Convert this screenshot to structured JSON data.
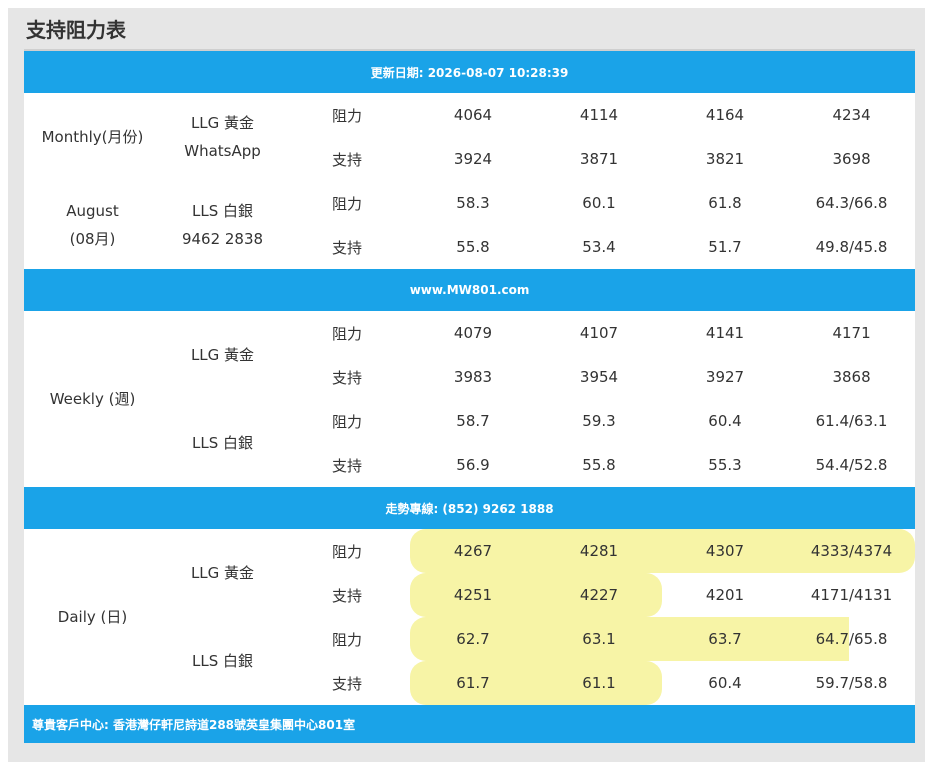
{
  "title": "支持阻力表",
  "update_band": "更新日期: 2026-08-07 10:28:39",
  "site_band": "www.MW801.com",
  "hotline_band": "走勢專線: (852) 9262 1888",
  "footer": "尊貴客戶中心: 香港灣仔軒尼詩道288號英皇集團中心801室",
  "monthly": {
    "period_line1": "Monthly(月份)",
    "period_line2": "August",
    "period_line3": "(08月)",
    "llg_label": "LLG 黃金",
    "whatsapp_label": "WhatsApp",
    "lls_label": "LLS 白銀",
    "phone": "9462 2838",
    "rows": [
      {
        "kind": "阻力",
        "v": [
          "4064",
          "4114",
          "4164",
          "4234"
        ]
      },
      {
        "kind": "支持",
        "v": [
          "3924",
          "3871",
          "3821",
          "3698"
        ]
      },
      {
        "kind": "阻力",
        "v": [
          "58.3",
          "60.1",
          "61.8",
          "64.3/66.8"
        ]
      },
      {
        "kind": "支持",
        "v": [
          "55.8",
          "53.4",
          "51.7",
          "49.8/45.8"
        ]
      }
    ]
  },
  "weekly": {
    "period_label": "Weekly (週)",
    "llg_label": "LLG 黃金",
    "lls_label": "LLS 白銀",
    "rows": [
      {
        "kind": "阻力",
        "v": [
          "4079",
          "4107",
          "4141",
          "4171"
        ]
      },
      {
        "kind": "支持",
        "v": [
          "3983",
          "3954",
          "3927",
          "3868"
        ]
      },
      {
        "kind": "阻力",
        "v": [
          "58.7",
          "59.3",
          "60.4",
          "61.4/63.1"
        ]
      },
      {
        "kind": "支持",
        "v": [
          "56.9",
          "55.8",
          "55.3",
          "54.4/52.8"
        ]
      }
    ]
  },
  "daily": {
    "period_label": "Daily (日)",
    "llg_label": "LLG 黃金",
    "lls_label": "LLS 白銀",
    "rows": [
      {
        "kind": "阻力",
        "v": [
          "4267",
          "4281",
          "4307",
          "4333/4374"
        ]
      },
      {
        "kind": "支持",
        "v": [
          "4251",
          "4227",
          "4201",
          "4171/4131"
        ]
      },
      {
        "kind": "阻力",
        "v": [
          "62.7",
          "63.1",
          "63.7",
          "64.7/65.8"
        ]
      },
      {
        "kind": "支持",
        "v": [
          "61.7",
          "61.1",
          "60.4",
          "59.7/58.8"
        ]
      }
    ]
  },
  "highlight_color": "#f7f4a6",
  "band_color": "#1aa3e8"
}
